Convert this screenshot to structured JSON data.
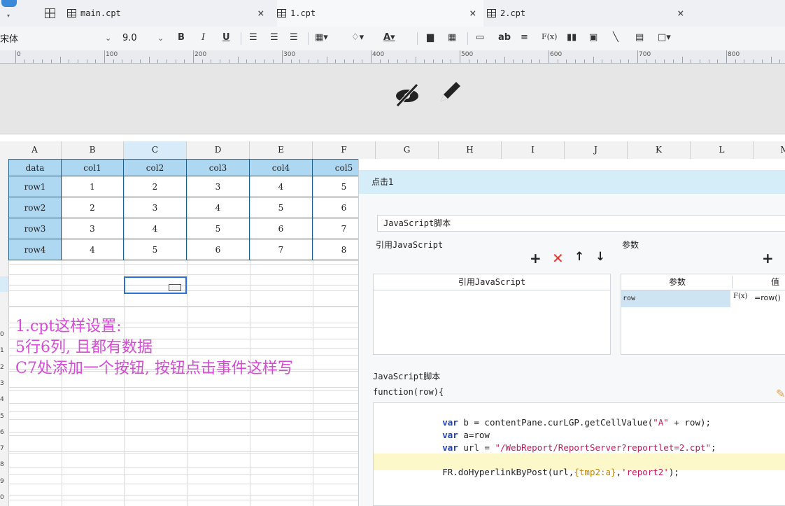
{
  "tabs": [
    {
      "label": "main.cpt"
    },
    {
      "label": "1.cpt"
    },
    {
      "label": "2.cpt"
    }
  ],
  "toolbar": {
    "font_name": "宋体",
    "font_size": "9.0",
    "bold": "B",
    "italic": "I",
    "underline": "U",
    "ab": "ab",
    "fx": "F(x)"
  },
  "ruler": [
    "0",
    "100",
    "200",
    "300",
    "400",
    "500",
    "600",
    "700",
    "800"
  ],
  "columns": [
    "A",
    "B",
    "C",
    "D",
    "E",
    "F",
    "G",
    "H",
    "I",
    "J",
    "K",
    "L",
    "M"
  ],
  "row_numbers": [
    "0",
    "1",
    "2",
    "3",
    "4",
    "5",
    "6",
    "7",
    "8",
    "9",
    "0"
  ],
  "table": {
    "header": [
      "data",
      "col1",
      "col2",
      "col3",
      "col4",
      "col5"
    ],
    "rows": [
      [
        "row1",
        "1",
        "2",
        "3",
        "4",
        "5"
      ],
      [
        "row2",
        "2",
        "3",
        "4",
        "5",
        "6"
      ],
      [
        "row3",
        "3",
        "4",
        "5",
        "6",
        "7"
      ],
      [
        "row4",
        "4",
        "5",
        "6",
        "7",
        "8"
      ]
    ]
  },
  "note": {
    "line1": "1.cpt这样设置:",
    "line2": "5行6列, 且都有数据",
    "line3": "C7处添加一个按钮, 按钮点击事件这样写"
  },
  "dialog": {
    "title": "点击1",
    "type_value": "JavaScript脚本",
    "ref_js_label": "引用JavaScript",
    "params_label": "参数",
    "ref_js_col": "引用JavaScript",
    "params_col": "参数",
    "params_col2": "值",
    "param_name": "row",
    "param_value": "=row()",
    "script_label": "JavaScript脚本",
    "func_sig": "function(row){",
    "code": {
      "l1_kw": "var",
      "l1_rest": " b = contentPane.curLGP.getCellValue(",
      "l1_str": "\"A\"",
      "l1_end": " + row);",
      "l2_kw": "var",
      "l2_rest": " a=row",
      "l3_kw": "var",
      "l3_rest": " url = ",
      "l3_str": "\"/WebReport/ReportServer?reportlet=2.cpt\"",
      "l3_end": ";",
      "l4_a": "FR.doHyperlinkByPost(url,",
      "l4_b": "{tmp2:a}",
      "l4_c": ",",
      "l4_str": "'report2'",
      "l4_end": ");"
    }
  }
}
